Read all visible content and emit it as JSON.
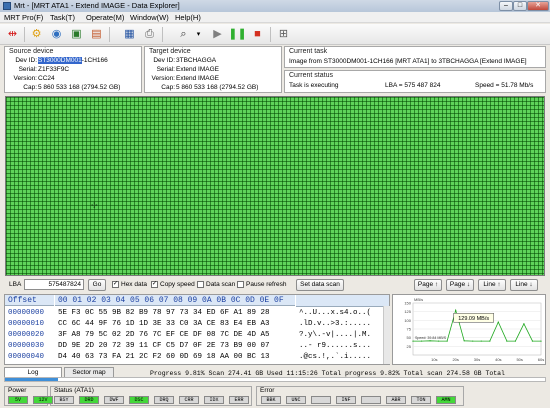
{
  "window": {
    "title": "Mrt - [MRT ATA1 - Extend IMAGE - Data Explorer]",
    "min": "–",
    "max": "□",
    "close": "✕"
  },
  "menu": [
    "MRT Pro(F)",
    "Task(T)",
    "Operate(M)",
    "Window(W)",
    "Help(H)"
  ],
  "source": {
    "title": "Source device",
    "dev_label": "Dev ID:",
    "dev_sel": "ST3000DM001",
    "dev_rest": "-1CH166",
    "serial_label": "Serial:",
    "serial": "Z1F33F9C",
    "version_label": "Version:",
    "version": "CC24",
    "cap_label": "Cap:",
    "cap": "5 860 533 168 (2794.52 GB)"
  },
  "target": {
    "title": "Target device",
    "dev_label": "Dev ID:",
    "dev": "3TBCHAGGA",
    "serial_label": "Serial:",
    "serial": "Extend IMAGE",
    "version_label": "Version:",
    "version": "Extend IMAGE",
    "cap_label": "Cap:",
    "cap": "5 860 533 168 (2794.52 GB)"
  },
  "task": {
    "title": "Current task",
    "text": "Image from ST3000DM001-1CH166 [MRT ATA1] to 3TBCHAGGA [Extend IMAGE]",
    "status_title": "Current status",
    "status": "Task is executing",
    "lba": "LBA = 575 487 824",
    "speed": "Speed = 51.78 Mb/s"
  },
  "controls": {
    "lba_label": "LBA",
    "lba_value": "575487824",
    "go": "Go",
    "hex_data": "Hex data",
    "copy_speed": "Copy speed",
    "data_scan": "Data scan",
    "pause_refresh": "Pause refresh",
    "set_data_scan": "Set data scan",
    "page_up": "Page ↑",
    "page_down": "Page ↓",
    "line_up": "Line ↑",
    "line_down": "Line ↓"
  },
  "hex": {
    "header_offset": "Offset",
    "header_cols": "00 01 02 03 04 05 06 07 08 09 0A 0B 0C 0D 0E 0F",
    "rows": [
      {
        "off": "00000000",
        "bytes": "5E F3 0C 55 9B 82 B9 78 97 73 34 ED 6F A1 89 28",
        "ascii": "^..U...x.s4.o..("
      },
      {
        "off": "00000010",
        "bytes": "CC 6C 44 9F 76 1D 1D 3E 33 C0 3A CE 83 E4 EB A3",
        "ascii": ".lD.v..>3.:....."
      },
      {
        "off": "00000020",
        "bytes": "3F A8 79 5C 02 2D 76 7C EF CE DF 08 7C DE 4D A5",
        "ascii": "?.y\\.-v|....|.M."
      },
      {
        "off": "00000030",
        "bytes": "DD 9E 2D 20 72 39 11 CF C5 D7 0F 2E 73 B9 00 07",
        "ascii": "..- r9......s..."
      },
      {
        "off": "00000040",
        "bytes": "D4 40 63 73 FA 21 2C F2 60 0D 69 18 AA 00 BC 13",
        "ascii": ".@cs.!,.`.i....."
      }
    ]
  },
  "chart": {
    "unit": "MB/s",
    "tooltip": "129.09 MB/s",
    "speed_note": "Speed: 39.84 MB/S",
    "y_ticks": [
      "150",
      "125",
      "100",
      "75",
      "50",
      "25"
    ],
    "x_ticks": [
      "10s",
      "20s",
      "30s",
      "40s",
      "50s",
      "60s"
    ],
    "chart_data": {
      "type": "line",
      "x": [
        0,
        4,
        8,
        12,
        16,
        20,
        24,
        28,
        32,
        36,
        40,
        44,
        48,
        52,
        56,
        60
      ],
      "values": [
        40,
        40,
        41,
        40,
        40,
        129,
        41,
        40,
        40,
        40,
        95,
        40,
        40,
        90,
        40,
        40
      ],
      "ylim": [
        0,
        150
      ],
      "xlim": [
        0,
        60
      ],
      "ylabel": "MB/s"
    }
  },
  "tabs": [
    "Log",
    "Sector map"
  ],
  "progress": {
    "fraction": 0.0981,
    "text": "Progress 9.81% Scan 274.41 GB Used 11:15:26   Total progress 9.82% Total scan 274.58 GB Total"
  },
  "status": {
    "power_label": "Power",
    "power": [
      "5V",
      "12V"
    ],
    "ata_label": "Status (ATA1)",
    "ata": [
      "BSY",
      "DRD",
      "DWF",
      "DSC",
      "DRQ",
      "CRR",
      "IDX",
      "ERR"
    ],
    "error_label": "Error",
    "error": [
      "BBK",
      "UNC",
      "",
      "INF",
      "",
      "ABR",
      "TON",
      "AMN"
    ]
  },
  "colors": {
    "sector_ok": "#5fd35a",
    "progress": "#3f8fd8",
    "led_on": "#44d83a",
    "led_red": "#e43c3c"
  }
}
